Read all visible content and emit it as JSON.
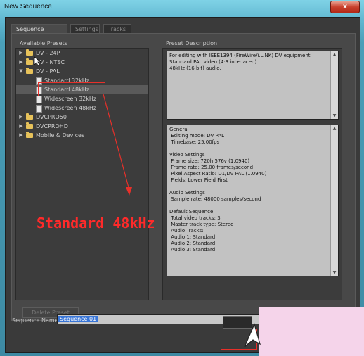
{
  "window": {
    "title": "New Sequence",
    "close_label": "x"
  },
  "tabs": [
    {
      "label": "Sequence Presets",
      "active": true
    },
    {
      "label": "Settings",
      "active": false
    },
    {
      "label": "Tracks",
      "active": false
    }
  ],
  "presets": {
    "heading": "Available Presets",
    "items": [
      {
        "label": "DV - 24P",
        "type": "folder",
        "expanded": false,
        "level": 0
      },
      {
        "label": "DV - NTSC",
        "type": "folder",
        "expanded": false,
        "level": 0
      },
      {
        "label": "DV - PAL",
        "type": "folder",
        "expanded": true,
        "level": 0
      },
      {
        "label": "Standard 32kHz",
        "type": "preset",
        "level": 1
      },
      {
        "label": "Standard 48kHz",
        "type": "preset",
        "level": 1,
        "selected": true
      },
      {
        "label": "Widescreen 32kHz",
        "type": "preset",
        "level": 1
      },
      {
        "label": "Widescreen 48kHz",
        "type": "preset",
        "level": 1
      },
      {
        "label": "DVCPRO50",
        "type": "folder",
        "expanded": false,
        "level": 0
      },
      {
        "label": "DVCPROHD",
        "type": "folder",
        "expanded": false,
        "level": 0
      },
      {
        "label": "Mobile & Devices",
        "type": "folder",
        "expanded": false,
        "level": 0
      }
    ],
    "delete_label": "Delete Preset"
  },
  "description": {
    "heading": "Preset Description",
    "summary": "For editing with IEEE1394 (FireWire/i.LINK) DV equipment.\nStandard PAL video (4:3 interlaced).\n48kHz (16 bit) audio.",
    "details": "General\n Editing mode: DV PAL\n Timebase: 25.00fps\n\nVideo Settings\n Frame size: 720h 576v (1.0940)\n Frame rate: 25.00 frames/second\n Pixel Aspect Ratio: D1/DV PAL (1.0940)\n Fields: Lower Field First\n\nAudio Settings\n Sample rate: 48000 samples/second\n\nDefault Sequence\n Total video tracks: 3\n Master track type: Stereo\n Audio Tracks:\n Audio 1: Standard\n Audio 2: Standard\n Audio 3: Standard"
  },
  "sequence": {
    "label": "Sequence Name:",
    "value": "Sequence 01"
  },
  "annotation": {
    "text": "Standard 48kHz",
    "color": "#ff2a2a"
  }
}
